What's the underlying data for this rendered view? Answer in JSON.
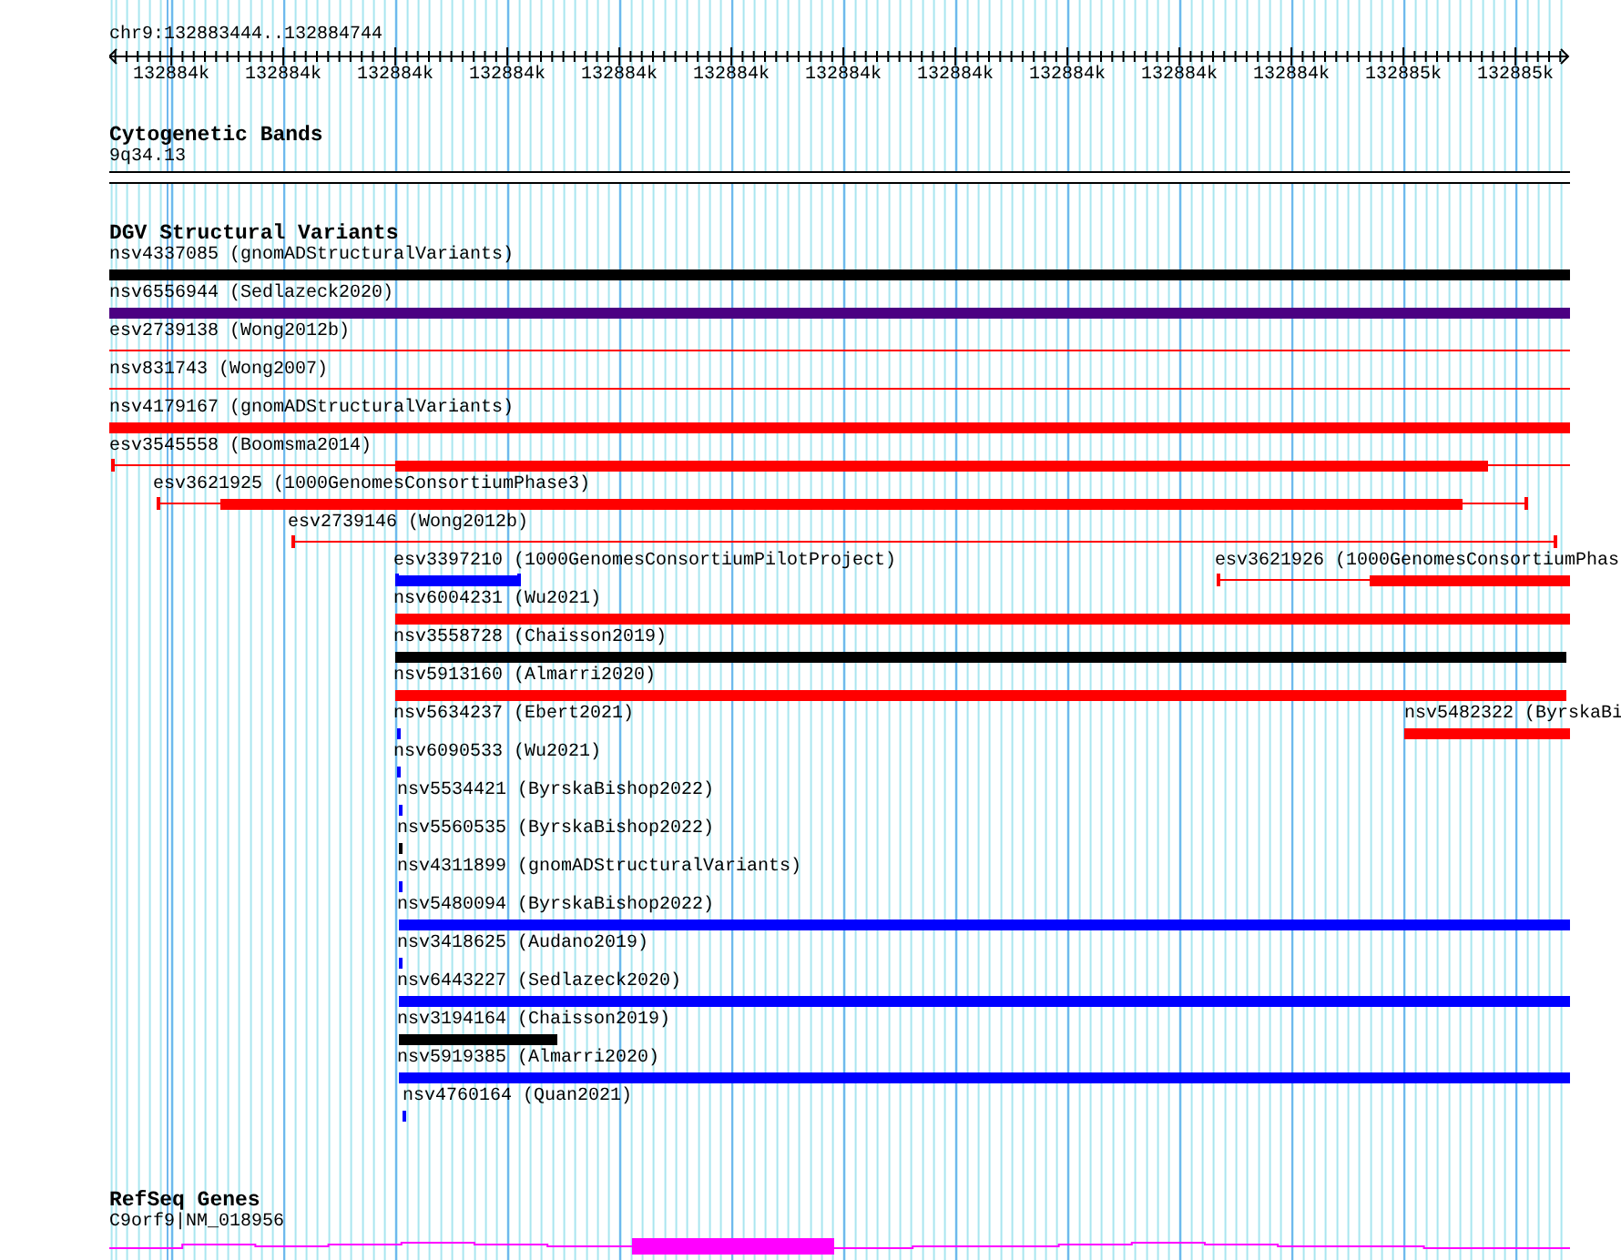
{
  "ruler": {
    "location": "chr9:132883444..132884744",
    "tick_labels": [
      "132884k",
      "132884k",
      "132884k",
      "132884k",
      "132884k",
      "132884k",
      "132884k",
      "132884k",
      "132884k",
      "132884k",
      "132884k",
      "132885k",
      "132885k"
    ]
  },
  "cytogenetic_bands": {
    "title": "Cytogenetic Bands",
    "band": "9q34.13"
  },
  "dgv_structural_variants": {
    "title": "DGV Structural Variants",
    "rows": [
      {
        "features": [
          {
            "label": "nsv4337085 (gnomADStructuralVariants)",
            "color": "#000000",
            "kind": "bar"
          }
        ]
      },
      {
        "features": [
          {
            "label": "nsv6556944 (Sedlazeck2020)",
            "color": "#4b0082",
            "kind": "bar"
          }
        ]
      },
      {
        "features": [
          {
            "label": "esv2739138 (Wong2012b)",
            "color": "#ff0000",
            "kind": "line"
          }
        ]
      },
      {
        "features": [
          {
            "label": "nsv831743 (Wong2007)",
            "color": "#ff0000",
            "kind": "line"
          }
        ]
      },
      {
        "features": [
          {
            "label": "nsv4179167 (gnomADStructuralVariants)",
            "color": "#ff0000",
            "kind": "bar"
          }
        ]
      },
      {
        "features": [
          {
            "label": "esv3545558 (Boomsma2014)",
            "color": "#ff0000",
            "kind": "segmented"
          }
        ]
      },
      {
        "features": [
          {
            "label": "esv3621925 (1000GenomesConsortiumPhase3)",
            "color": "#ff0000",
            "kind": "segmented"
          }
        ]
      },
      {
        "features": [
          {
            "label": "esv2739146 (Wong2012b)",
            "color": "#ff0000",
            "kind": "segmented"
          }
        ]
      },
      {
        "features": [
          {
            "label": "esv3397210 (1000GenomesConsortiumPilotProject)",
            "color": "#0000ff",
            "kind": "segmented"
          },
          {
            "label": "esv3621926 (1000GenomesConsortiumPhas",
            "color": "#ff0000",
            "kind": "segmented"
          }
        ]
      },
      {
        "features": [
          {
            "label": "nsv6004231 (Wu2021)",
            "color": "#ff0000",
            "kind": "bar"
          }
        ]
      },
      {
        "features": [
          {
            "label": "nsv3558728 (Chaisson2019)",
            "color": "#000000",
            "kind": "bar"
          }
        ]
      },
      {
        "features": [
          {
            "label": "nsv5913160 (Almarri2020)",
            "color": "#ff0000",
            "kind": "bar"
          }
        ]
      },
      {
        "features": [
          {
            "label": "nsv5634237 (Ebert2021)",
            "color": "#0000ff",
            "kind": "tick"
          },
          {
            "label": "nsv5482322 (ByrskaBi",
            "color": "#ff0000",
            "kind": "bar"
          }
        ]
      },
      {
        "features": [
          {
            "label": "nsv6090533 (Wu2021)",
            "color": "#0000ff",
            "kind": "tick"
          }
        ]
      },
      {
        "features": [
          {
            "label": "nsv5534421 (ByrskaBishop2022)",
            "color": "#0000ff",
            "kind": "tick"
          }
        ]
      },
      {
        "features": [
          {
            "label": "nsv5560535 (ByrskaBishop2022)",
            "color": "#000000",
            "kind": "tick"
          }
        ]
      },
      {
        "features": [
          {
            "label": "nsv4311899 (gnomADStructuralVariants)",
            "color": "#0000ff",
            "kind": "tick"
          }
        ]
      },
      {
        "features": [
          {
            "label": "nsv5480094 (ByrskaBishop2022)",
            "color": "#0000ff",
            "kind": "bar"
          }
        ]
      },
      {
        "features": [
          {
            "label": "nsv3418625 (Audano2019)",
            "color": "#0000ff",
            "kind": "tick"
          }
        ]
      },
      {
        "features": [
          {
            "label": "nsv6443227 (Sedlazeck2020)",
            "color": "#0000ff",
            "kind": "bar"
          }
        ]
      },
      {
        "features": [
          {
            "label": "nsv3194164 (Chaisson2019)",
            "color": "#000000",
            "kind": "bar"
          }
        ]
      },
      {
        "features": [
          {
            "label": "nsv5919385 (Almarri2020)",
            "color": "#0000ff",
            "kind": "bar"
          }
        ]
      },
      {
        "features": [
          {
            "label": "nsv4760164 (Quan2021)",
            "color": "#0000ff",
            "kind": "tick"
          }
        ]
      }
    ]
  },
  "refseq_genes": {
    "title": "RefSeq Genes",
    "gene": "C9orf9|NM_018956",
    "color": "#ff00ff"
  }
}
